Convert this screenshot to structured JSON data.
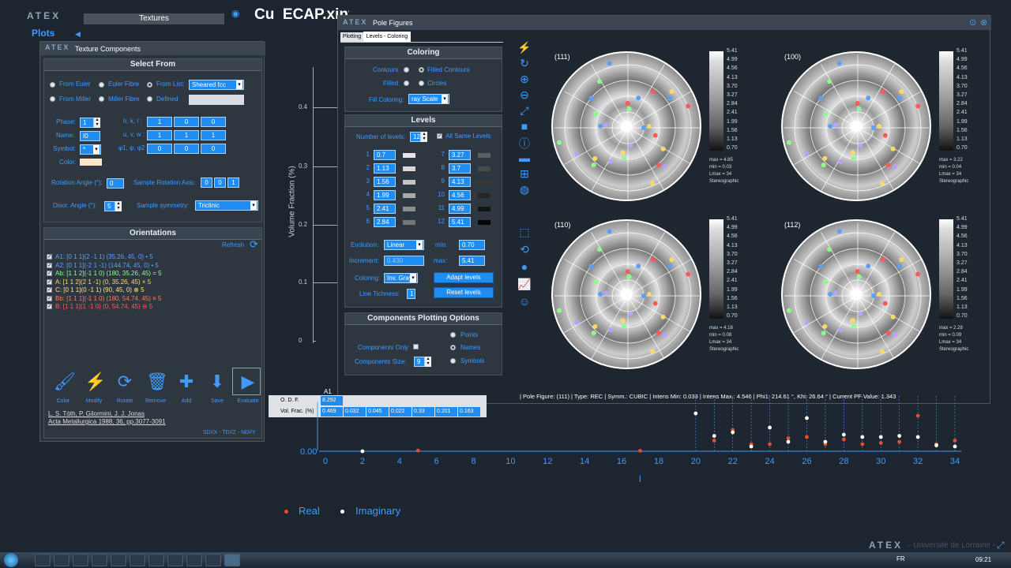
{
  "app": {
    "logo": "ATEX",
    "plots_label": "Plots",
    "textures_tab": "Textures",
    "title_fragment": "Cu_ECAP.xinf.sodf",
    "footer_logo": "ATEX",
    "footer_univ": "- Université de Lorraine -"
  },
  "texture": {
    "title": "Texture Components",
    "window_logo": "ATEX",
    "select_from": "Select From",
    "from_euler": "From Euler",
    "euler_fibre": "Euler Fibre",
    "from_list": "From List:",
    "list_value": "Sheared fcc",
    "from_miller": "From Miller",
    "miller_fibre": "Miller Fibre",
    "defined": "Defined",
    "phase_label": "Phase:",
    "phase_value": "1",
    "name_label": "Name:",
    "name_value": "I0",
    "symbol_label": "Symbol:",
    "symbol_value": "*",
    "color_label": "Color:",
    "hkl_label": "h, k, l :",
    "uvw_label": "u, v, w :",
    "phi_label": "φ1, φ, φ2",
    "hkl": [
      "1",
      "0",
      "0"
    ],
    "uvw": [
      "1",
      "1",
      "1"
    ],
    "phi": [
      "0",
      "0",
      "0"
    ],
    "rotation_label": "Rotation Angle (°):",
    "rotation_value": "0",
    "sample_rot_label": "Sample Rotation Axis:",
    "sample_rot": [
      "0",
      "0",
      "1"
    ],
    "disor_label": "Disor. Angle (°):",
    "disor_value": "5",
    "symmetry_label": "Sample symmetry:",
    "symmetry_value": "Triclinic",
    "orientations_title": "Orientations",
    "refresh": "Refresh",
    "orientations": [
      {
        "text": "A1: [0 1 1](2 -1 1) (35.26, 45, 0) • 5",
        "color": "#5aa0ff"
      },
      {
        "text": "A2: [0 1 1](-2 1 -1) (144.74, 45, 0) • 5",
        "color": "#5aa0ff"
      },
      {
        "text": "Ab: [1 1 2](-1 1 0) (180, 35.26, 45) = 5",
        "color": "#8cff8c"
      },
      {
        "text": "A: [1 1 2](2 1 -1) (0, 35.26, 45) × 5",
        "color": "#ffd966"
      },
      {
        "text": "C: [0 1 1](0 -1 1) (90, 45, 0) ⊗ 5",
        "color": "#ffe680"
      },
      {
        "text": "Bb: [1 1 1](-1 1 0) (180, 54.74, 45) ¤ 5",
        "color": "#ff7a5a"
      },
      {
        "text": "B: [1 1 1](1 -1 0) (0, 54.74, 45) ⊖ 5",
        "color": "#ff5a5a"
      }
    ],
    "actions": [
      {
        "label": "Color",
        "icon": "paint-roller-icon",
        "glyph": "🖌"
      },
      {
        "label": "Modify",
        "icon": "lightning-icon",
        "glyph": "⚡"
      },
      {
        "label": "Rotate",
        "icon": "rotate-icon",
        "glyph": "⟳"
      },
      {
        "label": "Remove",
        "icon": "trash-icon",
        "glyph": "🗑"
      },
      {
        "label": "Add",
        "icon": "plus-icon",
        "glyph": "✚"
      },
      {
        "label": "Save",
        "icon": "save-icon",
        "glyph": "⬇"
      },
      {
        "label": "Evaluate",
        "icon": "play-icon",
        "glyph": "▶"
      }
    ],
    "ref1": "L. S. Tóth, P. Gilormini, J. J. Jonas",
    "ref2": "Acta Metallurgica 1988, 36, pp.3077-3091",
    "axes_note": "SD//X - TD//Z - ND//Y"
  },
  "pole": {
    "title": "Pole Figures",
    "window_logo": "ATEX",
    "tab_plotting": "Plotting",
    "tab_levels": "Levels - Coloring",
    "coloring_title": "Coloring",
    "contours": "Contours",
    "filled_contours": "Filled Contours",
    "filled": "Filled",
    "circles": "Circles",
    "fill_coloring_label": "Fill Coloring:",
    "fill_coloring_value": "ray Scale",
    "levels_title": "Levels",
    "num_levels_label": "Number of levels:",
    "num_levels_value": "12",
    "all_same": "All Same Levels",
    "levels": [
      "0.7",
      "1.13",
      "1.56",
      "1.99",
      "2.41",
      "2.84",
      "3.27",
      "3.7",
      "4.13",
      "4.56",
      "4.99",
      "5.41"
    ],
    "level_colors": [
      "#e6e6e6",
      "#d8d8d8",
      "#c4c4c4",
      "#aaaaaa",
      "#8e8e8e",
      "#767676",
      "#5e5e5e",
      "#4a4a4a",
      "#383838",
      "#262626",
      "#141414",
      "#050505"
    ],
    "evolution_label": "Evolution:",
    "evolution_value": "Linear",
    "min_label": "min:",
    "min_value": "0.70",
    "increment_label": "Increment:",
    "increment_value": "0.430",
    "max_label": "max:",
    "max_value": "5.41",
    "coloring_label": "Coloring:",
    "coloring_value": "Inv. Gray",
    "adapt_levels": "Adapt levels",
    "thickness_label": "Line Tichness:",
    "thickness_value": "1",
    "reset_levels": "Reset levels",
    "comp_title": "Components Plotting Options",
    "points": "Points",
    "components_only": "Components Only",
    "names": "Names",
    "comp_size_label": "Components Size:",
    "comp_size_value": "9",
    "symbols": "Symbols",
    "figures": [
      {
        "label": "(111)",
        "max": "max = 4.85",
        "min": "min = 0.03",
        "lmax": "Lmax = 34",
        "proj": "Stereographic"
      },
      {
        "label": "(100)",
        "max": "max = 3.22",
        "min": "min = 0.04",
        "lmax": "Lmax = 34",
        "proj": "Stereographic"
      },
      {
        "label": "(110)",
        "max": "max = 4.18",
        "min": "min = 0.08",
        "lmax": "Lmax = 34",
        "proj": "Stereographic"
      },
      {
        "label": "(112)",
        "max": "max = 2.28",
        "min": "min = 0.09",
        "lmax": "Lmax = 34",
        "proj": "Stereographic"
      }
    ],
    "scale": [
      "5.41",
      "4.99",
      "4.56",
      "4.13",
      "3.70",
      "3.27",
      "2.84",
      "2.41",
      "1.99",
      "1.56",
      "1.13",
      "0.70"
    ],
    "status": "| Pole Figure: (111) | Type: REC | Symm.: CUBIC | Intens Min: 0.033 | Intens Max.: 4.546 | Phi1: 214.61 °, Khi: 26.64 ° | Current PF Value: 1.343"
  },
  "table": {
    "col": "A1",
    "odf_label": "O. D. F.",
    "vol_label": "Vol. Frac. (%)",
    "odf_first": "8.292",
    "vol": [
      "0.469",
      "0.032",
      "0.045",
      "0.022",
      "0.33",
      "0.201",
      "0.163"
    ]
  },
  "vf": {
    "ylabel": "Volume Fraction (%)",
    "ticks": [
      "0.4",
      "0.3",
      "0.2",
      "0.1",
      "0"
    ]
  },
  "chart_data": {
    "type": "scatter",
    "xlabel": "l",
    "ylabel": "",
    "y_tick_label": "0.00",
    "x_ticks": [
      "0",
      "2",
      "4",
      "6",
      "8",
      "10",
      "12",
      "14",
      "16",
      "18",
      "20",
      "22",
      "24",
      "26",
      "28",
      "30",
      "32",
      "34"
    ],
    "series": [
      {
        "name": "Real",
        "color": "#e0502a",
        "points": [
          [
            5,
            0.003
          ],
          [
            17,
            0.002
          ],
          [
            21,
            0.045
          ],
          [
            22,
            0.09
          ],
          [
            23,
            0.03
          ],
          [
            24,
            0.03
          ],
          [
            25,
            0.055
          ],
          [
            26,
            0.06
          ],
          [
            27,
            0.03
          ],
          [
            28,
            0.05
          ],
          [
            29,
            0.03
          ],
          [
            30,
            0.035
          ],
          [
            31,
            0.04
          ],
          [
            32,
            0.15
          ],
          [
            33,
            0.03
          ],
          [
            34,
            0.045
          ]
        ]
      },
      {
        "name": "Imaginary",
        "color": "#ffffff",
        "points": [
          [
            2,
            0.0
          ],
          [
            20,
            0.16
          ],
          [
            21,
            0.065
          ],
          [
            22,
            0.08
          ],
          [
            23,
            0.02
          ],
          [
            24,
            0.1
          ],
          [
            25,
            0.04
          ],
          [
            26,
            0.14
          ],
          [
            27,
            0.04
          ],
          [
            28,
            0.07
          ],
          [
            29,
            0.06
          ],
          [
            30,
            0.06
          ],
          [
            31,
            0.065
          ],
          [
            32,
            0.06
          ],
          [
            33,
            0.025
          ],
          [
            34,
            0.02
          ]
        ]
      }
    ]
  },
  "taskbar": {
    "lang": "FR",
    "time": "09:21"
  }
}
